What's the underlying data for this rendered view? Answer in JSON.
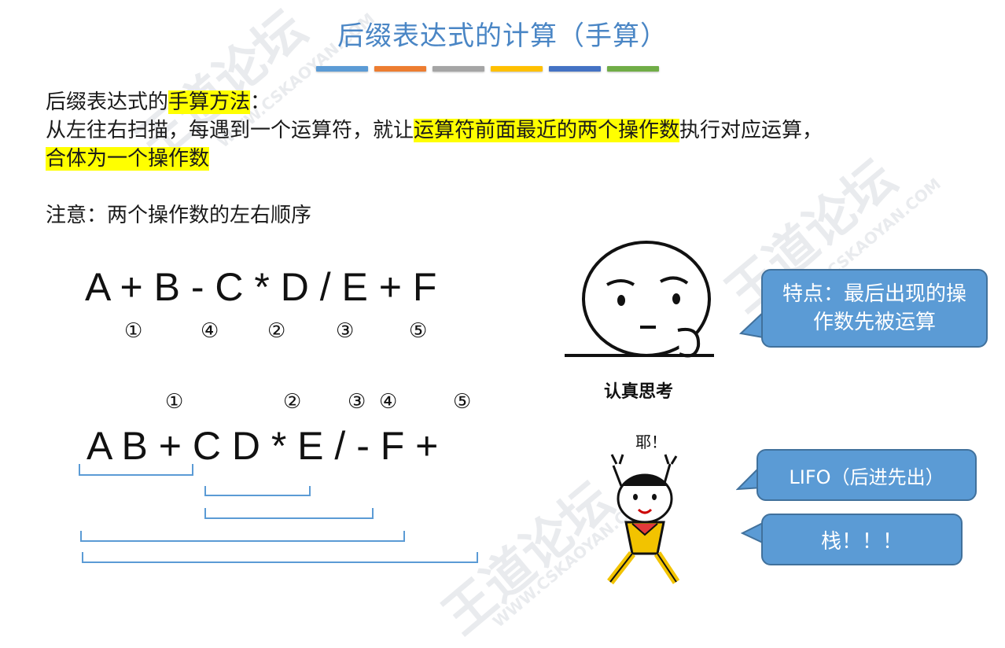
{
  "title": "后缀表达式的计算（手算）",
  "accent_bars": [
    "#5b9bd5",
    "#ed7d31",
    "#a5a5a5",
    "#ffc000",
    "#4472c4",
    "#70ad47"
  ],
  "method": {
    "line1_a": "后缀表达式的",
    "line1_hl": "手算方法",
    "line1_b": "：",
    "line2_a": "从左往右扫描，每遇到一个运算符，就让",
    "line2_hl": "运算符前面最近的两个操作数",
    "line2_b": "执行对应运算，",
    "line3_hl": "合体为一个操作数"
  },
  "note": "注意：两个操作数的左右顺序",
  "infix": {
    "expr": "A + B - C * D / E + F",
    "order": [
      "①",
      "④",
      "②",
      "③",
      "⑤"
    ]
  },
  "postfix": {
    "expr": "A B + C D * E / - F +",
    "order": [
      "①",
      "②",
      "③",
      "④",
      "⑤"
    ]
  },
  "bubbles": {
    "feature": "特点：最后出现的操作数先被运算",
    "lifo": "LIFO（后进先出）",
    "stack": "栈！！！"
  },
  "stickers": {
    "thinking_caption": "认真思考",
    "yeah_caption": "耶！"
  },
  "watermark": {
    "brand": "王道论坛",
    "url": "WWW.CSKAOYAN.COM"
  }
}
